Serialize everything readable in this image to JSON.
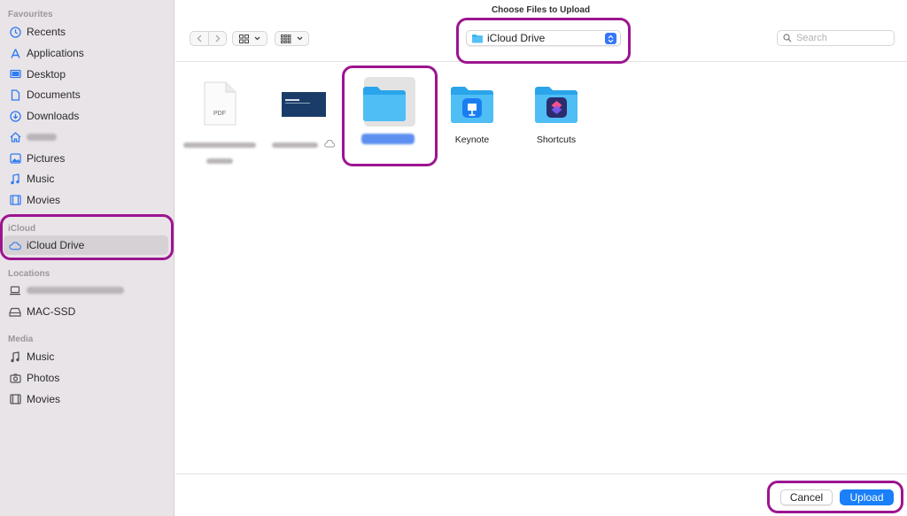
{
  "window": {
    "title": "Choose Files to Upload"
  },
  "sidebar": {
    "favourites_title": "Favourites",
    "favourites": [
      {
        "label": "Recents",
        "icon": "clock-icon"
      },
      {
        "label": "Applications",
        "icon": "applications-icon"
      },
      {
        "label": "Desktop",
        "icon": "desktop-icon"
      },
      {
        "label": "Documents",
        "icon": "document-icon"
      },
      {
        "label": "Downloads",
        "icon": "download-icon"
      },
      {
        "label": "",
        "icon": "home-icon",
        "blurred": true
      },
      {
        "label": "Pictures",
        "icon": "pictures-icon"
      },
      {
        "label": "Music",
        "icon": "music-icon"
      },
      {
        "label": "Movies",
        "icon": "movies-icon"
      }
    ],
    "icloud_title": "iCloud",
    "icloud": [
      {
        "label": "iCloud Drive",
        "icon": "cloud-icon",
        "selected": true
      }
    ],
    "locations_title": "Locations",
    "locations": [
      {
        "label": "",
        "icon": "laptop-icon",
        "blurred": true
      },
      {
        "label": "MAC-SSD",
        "icon": "drive-icon"
      }
    ],
    "media_title": "Media",
    "media": [
      {
        "label": "Music",
        "icon": "music-icon"
      },
      {
        "label": "Photos",
        "icon": "camera-icon"
      },
      {
        "label": "Movies",
        "icon": "movies-icon"
      }
    ]
  },
  "toolbar": {
    "location": "iCloud Drive",
    "search_placeholder": "Search"
  },
  "files": [
    {
      "name": "",
      "type": "pdf",
      "thumb_text": "PDF",
      "blurred": true
    },
    {
      "name": "",
      "type": "slide",
      "blurred": true
    },
    {
      "name": "",
      "type": "folder",
      "blurred": true,
      "selected": true
    },
    {
      "name": "Keynote",
      "type": "keynote-folder"
    },
    {
      "name": "Shortcuts",
      "type": "shortcuts-folder"
    }
  ],
  "footer": {
    "cancel_label": "Cancel",
    "upload_label": "Upload"
  },
  "colors": {
    "accent": "#1a7ff8",
    "sidebar_icon": "#2f7bf0",
    "annotation": "#9c158f",
    "folder": "#3bb3f3"
  }
}
